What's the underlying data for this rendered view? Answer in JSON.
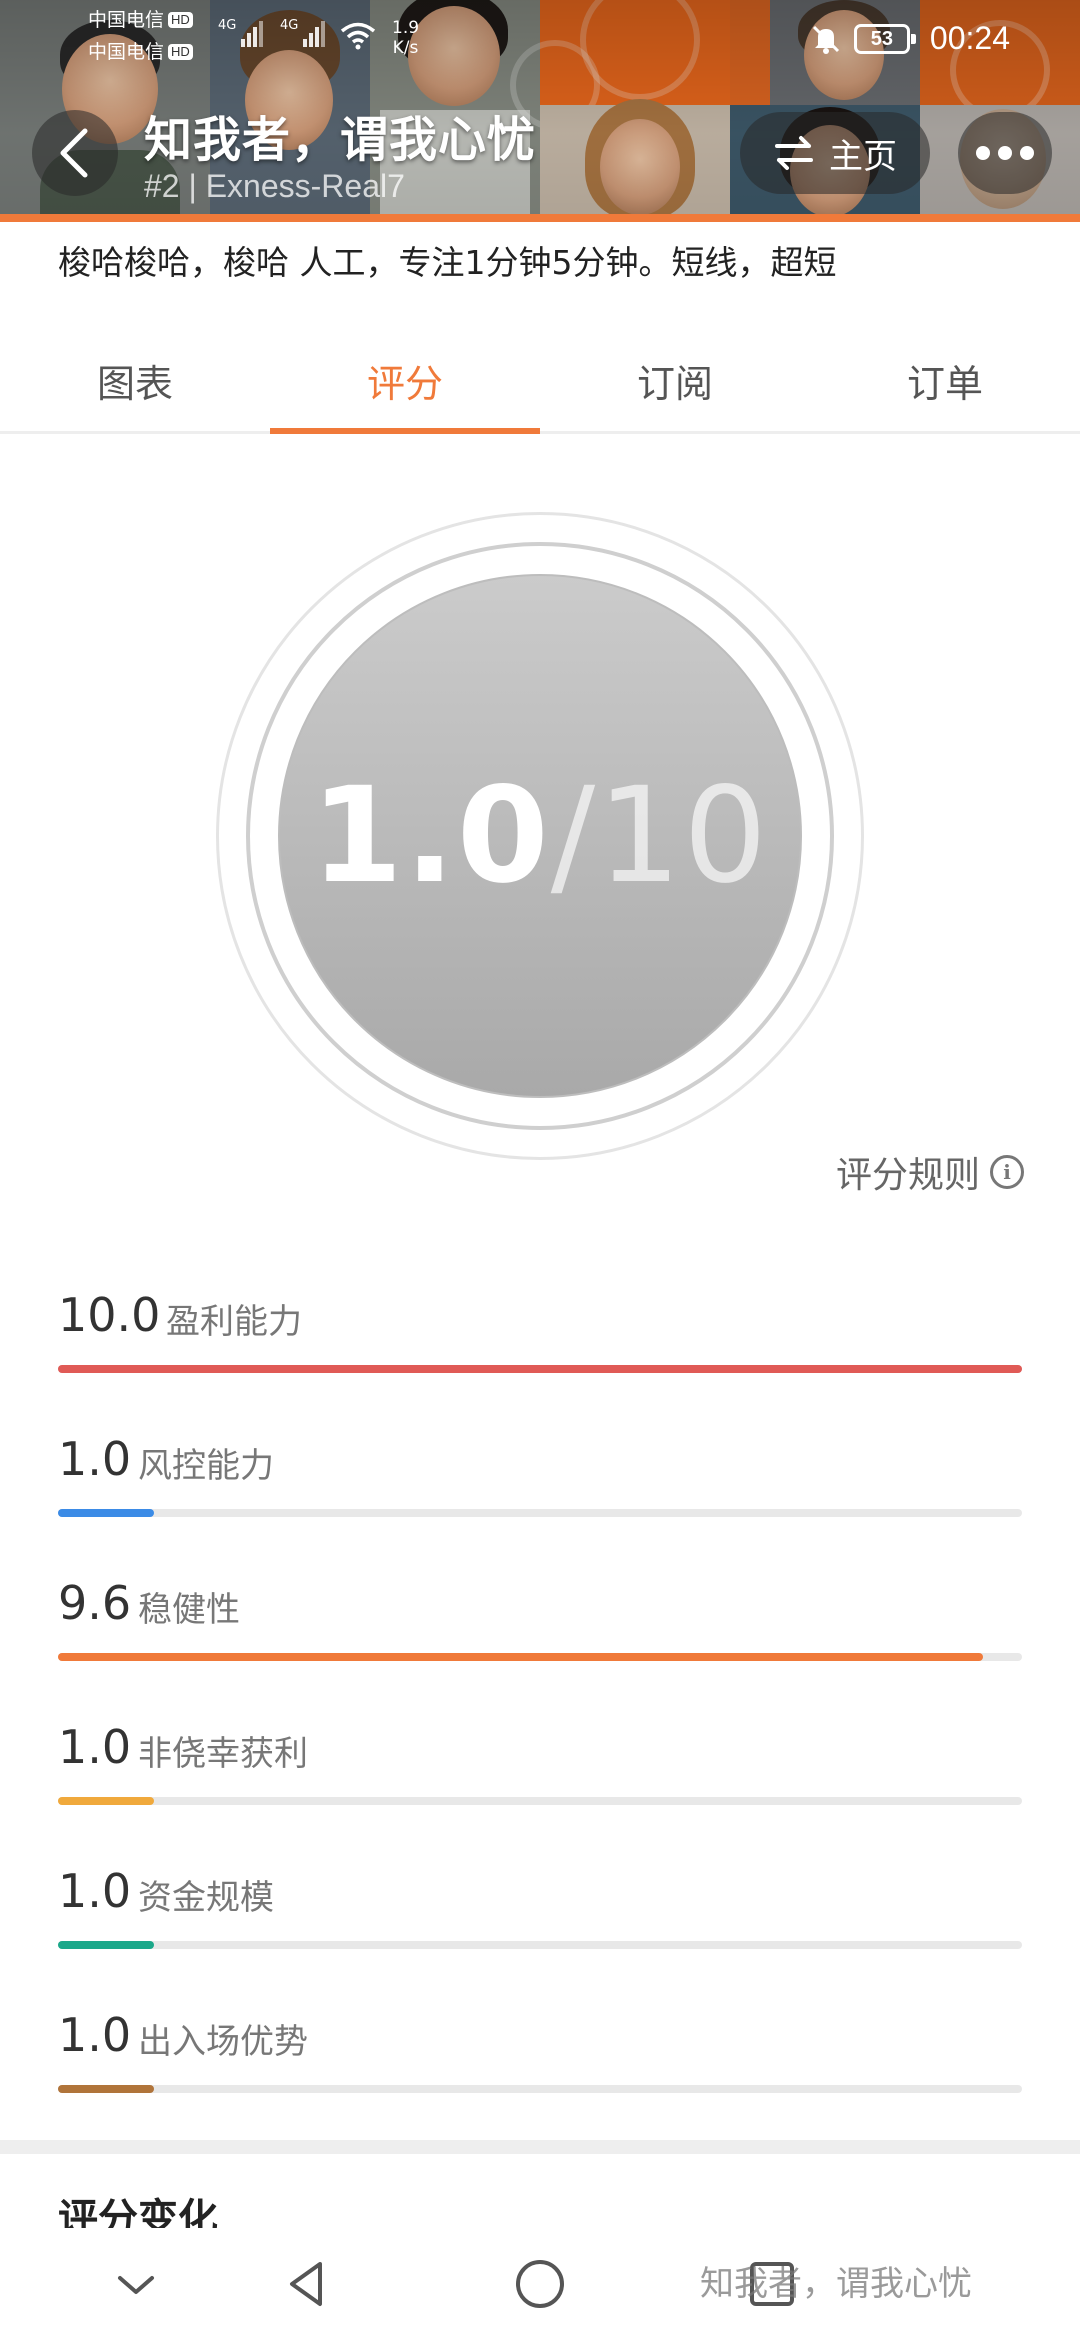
{
  "status_bar": {
    "carrier1": "中国电信",
    "carrier2": "中国电信",
    "hd": "HD",
    "network1": "4G",
    "network2": "4G",
    "net_speed_value": "1.9",
    "net_speed_unit": "K/s",
    "battery": "53",
    "time": "00:24"
  },
  "header": {
    "title": "知我者，谓我心忧",
    "subtitle": "#2 | Exness-Real7",
    "home_label": "主页"
  },
  "description": "梭哈梭哈，梭哈 人工，专注1分钟5分钟。短线，超短",
  "tabs": [
    {
      "label": "图表"
    },
    {
      "label": "评分"
    },
    {
      "label": "订阅"
    },
    {
      "label": "订单"
    }
  ],
  "active_tab": "评分",
  "score": {
    "value": "1.0",
    "max_text": "/10"
  },
  "rules_label": "评分规则",
  "metrics": [
    {
      "value": "10.0",
      "label": "盈利能力",
      "fraction": 1.0,
      "color": "#e05a56"
    },
    {
      "value": "1.0",
      "label": "风控能力",
      "fraction": 0.1,
      "color": "#3b8be6"
    },
    {
      "value": "9.6",
      "label": "稳健性",
      "fraction": 0.96,
      "color": "#f07a3a"
    },
    {
      "value": "1.0",
      "label": "非侥幸获利",
      "fraction": 0.1,
      "color": "#f0a93c"
    },
    {
      "value": "1.0",
      "label": "资金规模",
      "fraction": 0.1,
      "color": "#1ba88a"
    },
    {
      "value": "1.0",
      "label": "出入场优势",
      "fraction": 0.1,
      "color": "#b0743a"
    }
  ],
  "section_title": "评分变化",
  "watermark": "知我者，谓我心忧",
  "colors": {
    "accent": "#f07a3a",
    "header_orange": "#f26b1d"
  },
  "icons": {
    "back": "chevron-left-icon",
    "home": "swap-arrows-icon",
    "more": "more-dots-icon",
    "info": "info-icon",
    "nav": [
      "chevron-down-icon",
      "back-triangle-icon",
      "home-circle-icon",
      "recents-square-icon"
    ]
  }
}
